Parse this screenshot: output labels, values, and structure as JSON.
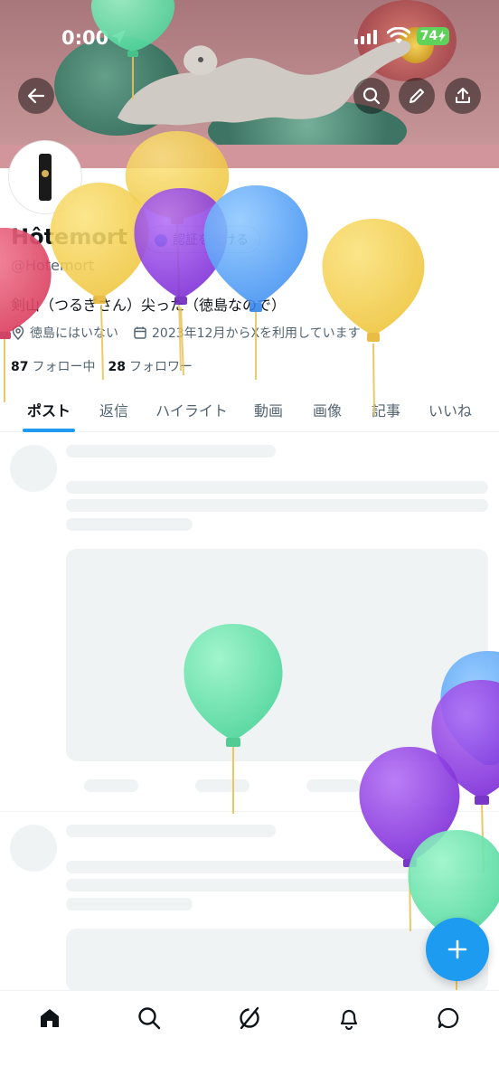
{
  "status_bar": {
    "time": "0:00",
    "battery": "74"
  },
  "header": {
    "back_icon": "arrow-left-icon",
    "search_icon": "search-icon",
    "edit_icon": "pencil-icon",
    "share_icon": "share-icon"
  },
  "profile": {
    "display_name": "Hôtemort",
    "verify_label": "認証を受ける",
    "handle": "@Hotemort",
    "bio": "剣山（つるぎさん）尖った（徳島なので）",
    "location": "徳島にはいない",
    "joined": "2023年12月からXを利用しています",
    "following_count": "87",
    "following_label": "フォロー中",
    "followers_count": "28",
    "followers_label": "フォロワー"
  },
  "tabs": [
    {
      "label": "ポスト",
      "active": true
    },
    {
      "label": "返信",
      "active": false
    },
    {
      "label": "ハイライト",
      "active": false
    },
    {
      "label": "動画",
      "active": false
    },
    {
      "label": "画像",
      "active": false
    },
    {
      "label": "記事",
      "active": false
    },
    {
      "label": "いいね",
      "active": false
    }
  ],
  "bottom_nav": [
    "home-icon",
    "search-icon",
    "grok-icon",
    "bell-icon",
    "message-icon"
  ],
  "fab_icon": "plus-icon",
  "colors": {
    "accent": "#1d9bf0",
    "text": "#0f1419",
    "secondary": "#536471",
    "skeleton": "#eff3f4"
  }
}
